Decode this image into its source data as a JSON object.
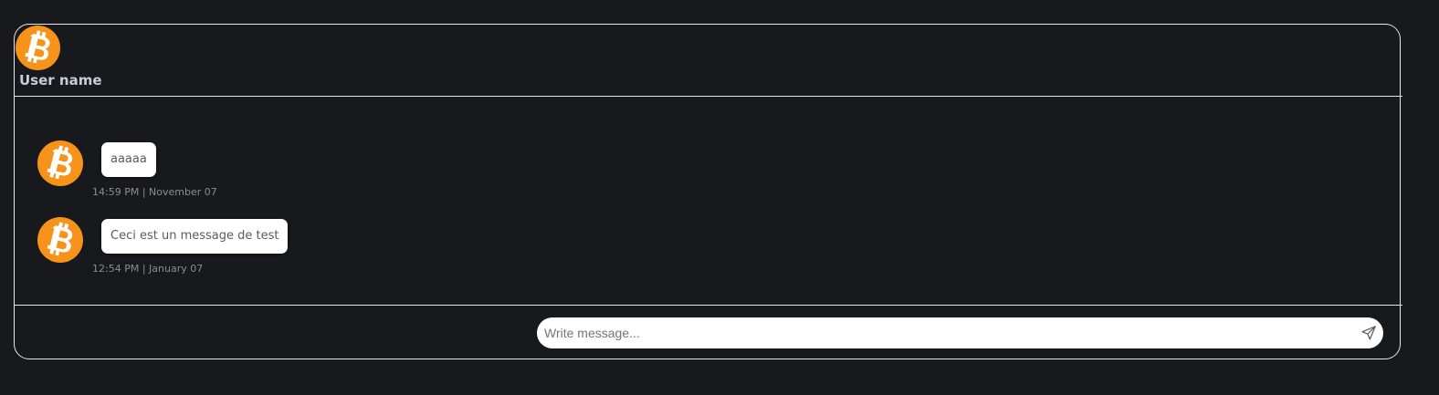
{
  "header": {
    "user_name": "User name",
    "avatar_icon": "bitcoin-icon"
  },
  "colors": {
    "background": "#18191d",
    "border": "#e8e8e8",
    "avatar_orange": "#f7931a",
    "bubble": "#ffffff"
  },
  "messages": [
    {
      "text": "aaaaa",
      "timestamp": "14:59 PM | November 07",
      "avatar_icon": "bitcoin-icon"
    },
    {
      "text": "Ceci est un message de test",
      "timestamp": "12:54 PM | January 07",
      "avatar_icon": "bitcoin-icon"
    }
  ],
  "composer": {
    "placeholder": "Write message...",
    "value": "",
    "send_icon": "send-icon"
  }
}
